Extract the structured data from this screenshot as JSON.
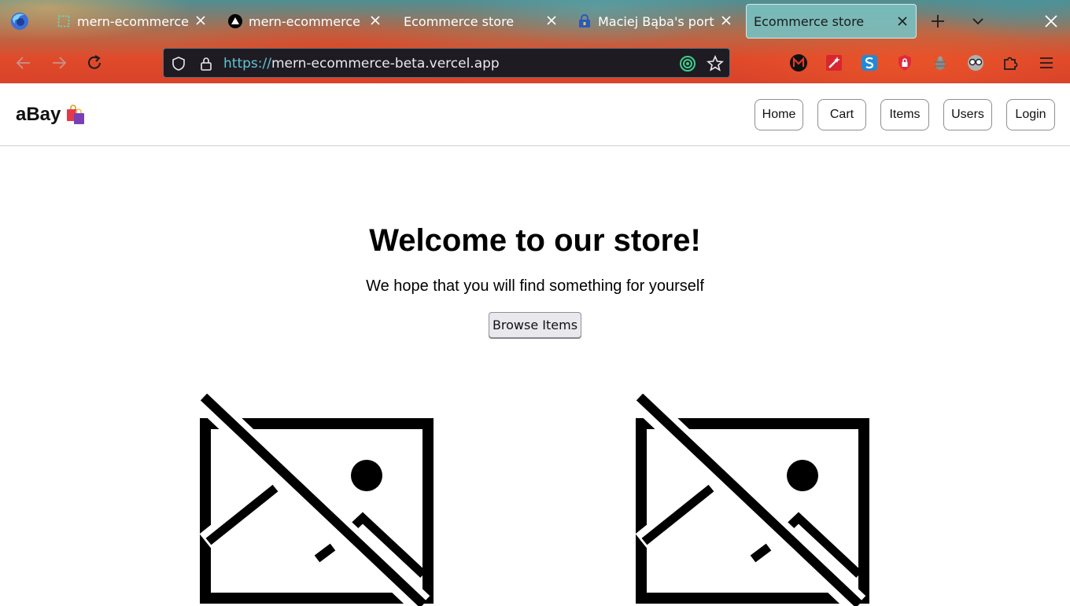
{
  "browser": {
    "tabs": [
      {
        "title": "mern-ecommerce",
        "active": false,
        "favicon": "dashed-square-icon"
      },
      {
        "title": "mern-ecommerce",
        "active": false,
        "favicon": "vercel-triangle-icon"
      },
      {
        "title": "Ecommerce store",
        "active": false,
        "favicon": ""
      },
      {
        "title": "Maciej Bąba's port",
        "active": false,
        "favicon": "lock-bag-icon"
      },
      {
        "title": "Ecommerce store",
        "active": true,
        "favicon": ""
      }
    ],
    "url_scheme": "https://",
    "url_host": "mern-ecommerce-beta.vercel.app",
    "colors": {
      "url_scheme": "#65c3d5",
      "active_tab": "#78bebe"
    }
  },
  "site": {
    "brand": "aBay",
    "nav": [
      {
        "label": "Home"
      },
      {
        "label": "Cart"
      },
      {
        "label": "Items"
      },
      {
        "label": "Users"
      },
      {
        "label": "Login"
      }
    ],
    "hero": {
      "title": "Welcome to our store!",
      "subtitle": "We hope that you will find something for yourself",
      "cta": "Browse Items"
    },
    "products": [
      {
        "image": "broken-image-icon"
      },
      {
        "image": "broken-image-icon"
      }
    ]
  }
}
